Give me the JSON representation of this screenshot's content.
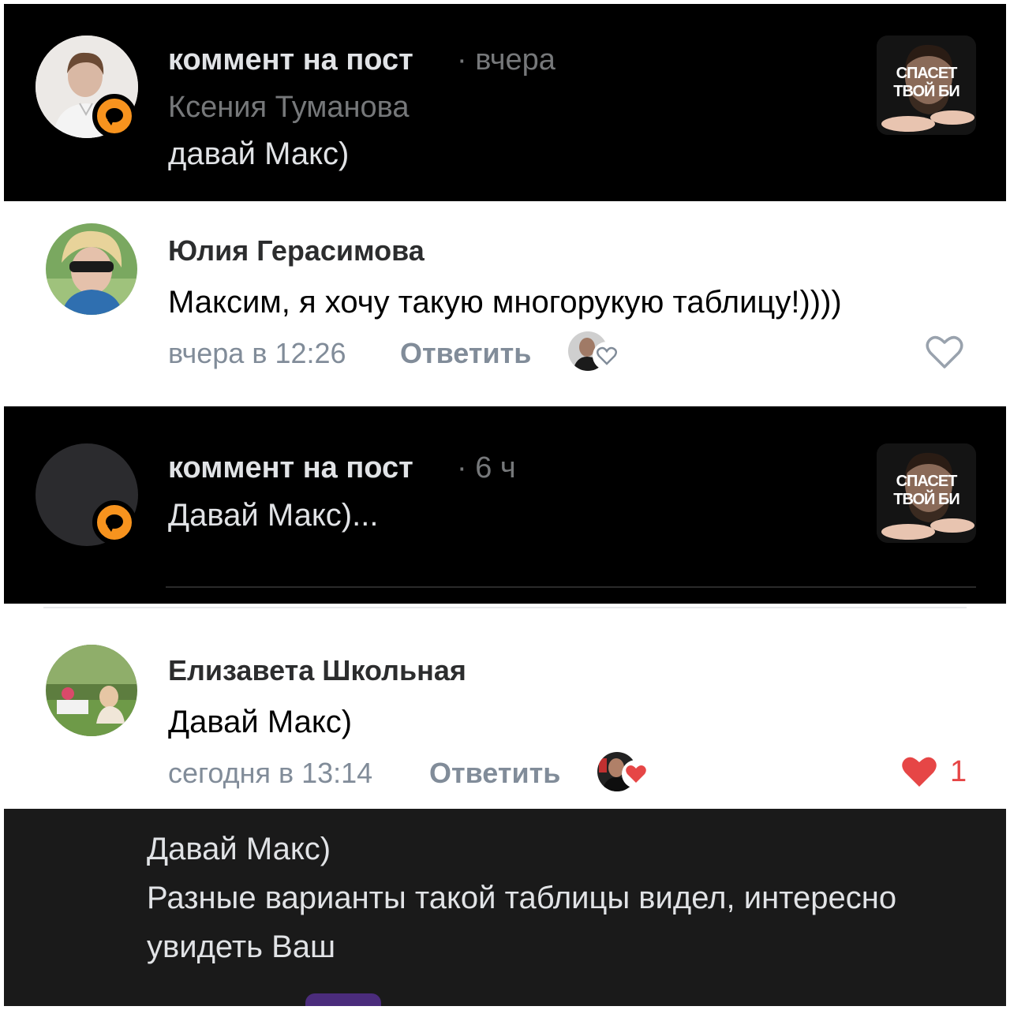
{
  "notifications": [
    {
      "title": "коммент на пост",
      "time": "· вчера",
      "author": "Ксения Туманова",
      "text": "давай Макс)",
      "thumb_caption": "СПАСЕТ ТВОЙ БИ"
    },
    {
      "title": "коммент на пост",
      "time": "· 6 ч",
      "text": "Давай Макс)...",
      "thumb_caption": "СПАСЕТ ТВОЙ БИ"
    }
  ],
  "comments": [
    {
      "author": "Юлия Герасимова",
      "text": "Максим, я хочу такую многорукую таблицу!))))",
      "time": "вчера в 12:26",
      "reply": "Ответить",
      "likes": ""
    },
    {
      "author": "Елизавета Школьная",
      "text": "Давай Макс)",
      "time": "сегодня в 13:14",
      "reply": "Ответить",
      "likes": "1"
    }
  ],
  "reply_message": {
    "line1": "Давай Макс)",
    "line2": "Разные варианты такой таблицы видел, интересно",
    "line3": "увидеть Ваш"
  },
  "colors": {
    "like_active": "#e64646",
    "badge": "#f7931e"
  }
}
